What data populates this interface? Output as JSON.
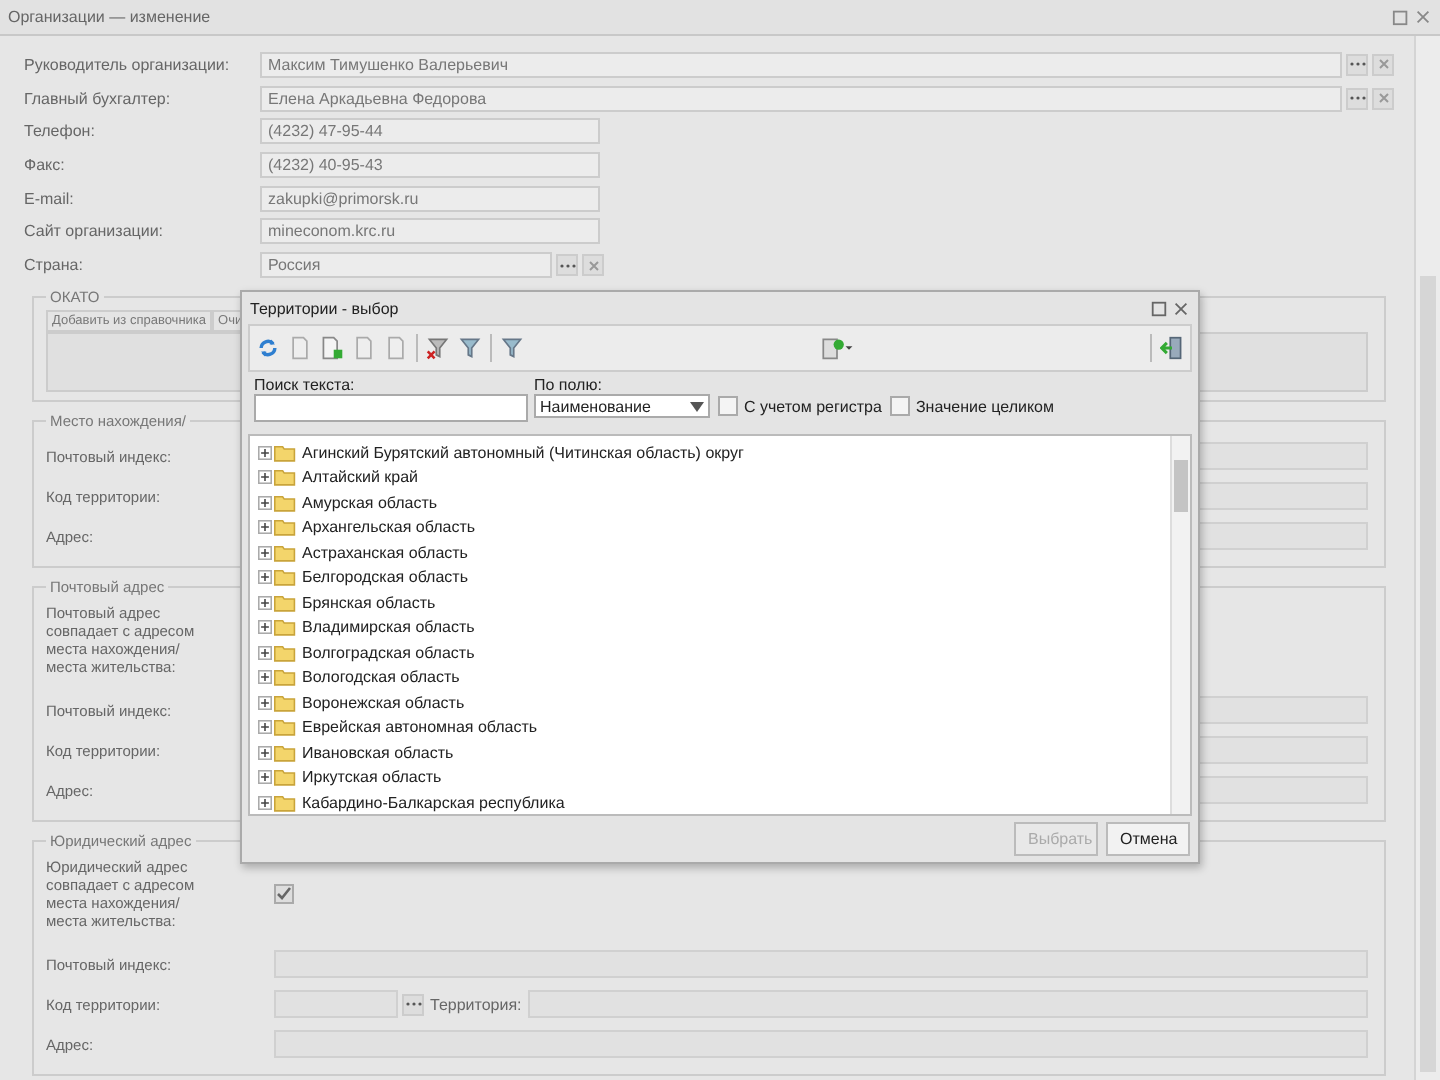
{
  "window": {
    "title": "Организации — изменение"
  },
  "fields": [
    {
      "label": "Руководитель организации:",
      "value": "Максим Тимушенко Валерьевич",
      "kind": "person"
    },
    {
      "label": "Главный бухгалтер:",
      "value": "Елена Аркадьевна Федорова",
      "kind": "person"
    },
    {
      "label": "Телефон:",
      "value": "(4232) 47-95-44",
      "kind": "contact"
    },
    {
      "label": "Факс:",
      "value": "(4232) 40-95-43",
      "kind": "contact"
    },
    {
      "label": "E-mail:",
      "value": "zakupki@primorsk.ru",
      "kind": "contact"
    },
    {
      "label": "Сайт организации:",
      "value": "mineconom.krc.ru",
      "kind": "contact"
    },
    {
      "label": "Страна:",
      "value": "Россия",
      "kind": "country"
    }
  ],
  "okato": {
    "title": "ОКАТО",
    "buttons": [
      "Добавить из справочника",
      "Очи"
    ]
  },
  "address_groups": [
    {
      "title": "Место нахождения/",
      "fields": [
        {
          "label": "Почтовый индекс:",
          "kind": "text"
        },
        {
          "label": "Код территории:",
          "kind": "text"
        },
        {
          "label": "Адрес:",
          "kind": "text"
        }
      ]
    },
    {
      "title": "Почтовый адрес",
      "same_label": "Почтовый адрес совпадает с адресом места нахождения/места жительства:",
      "fields": [
        {
          "label": "Почтовый индекс:",
          "kind": "text"
        },
        {
          "label": "Код территории:",
          "kind": "text"
        },
        {
          "label": "Адрес:",
          "kind": "text"
        }
      ]
    },
    {
      "title": "Юридический адрес",
      "same_label": "Юридический адрес совпадает с адресом места нахождения/места жительства:",
      "same_checked": true,
      "fields": [
        {
          "label": "Почтовый индекс:",
          "kind": "text"
        },
        {
          "label": "Код территории:",
          "kind": "territory",
          "extra_label": "Территория:"
        },
        {
          "label": "Адрес:",
          "kind": "text"
        }
      ]
    }
  ],
  "dialog": {
    "title": "Территории - выбор",
    "search_label": "Поиск текста:",
    "field_label": "По полю:",
    "field_value": "Наименование",
    "options": [
      {
        "label": "С учетом регистра",
        "checked": false
      },
      {
        "label": "Значение целиком",
        "checked": false
      }
    ],
    "tree": [
      {
        "label": "Агинский Бурятский автономный (Читинская область) округ",
        "expanded": false
      },
      {
        "label": "Алтайский край",
        "expanded": false
      },
      {
        "label": "Амурская область",
        "expanded": false
      },
      {
        "label": "Архангельская область",
        "expanded": false
      },
      {
        "label": "Астраханская область",
        "expanded": false
      },
      {
        "label": "Белгородская область",
        "expanded": false
      },
      {
        "label": "Брянская область",
        "expanded": false
      },
      {
        "label": "Владимирская область",
        "expanded": false
      },
      {
        "label": "Волгоградская область",
        "expanded": false
      },
      {
        "label": "Вологодская область",
        "expanded": false
      },
      {
        "label": "Воронежская область",
        "expanded": false
      },
      {
        "label": "Еврейская автономная область",
        "expanded": false
      },
      {
        "label": "Ивановская область",
        "expanded": false
      },
      {
        "label": "Иркутская область",
        "expanded": false
      },
      {
        "label": "Кабардино-Балкарская республика",
        "expanded": false
      }
    ],
    "buttons": [
      {
        "label": "Выбрать",
        "disabled": true
      },
      {
        "label": "Отмена",
        "disabled": false
      }
    ]
  }
}
